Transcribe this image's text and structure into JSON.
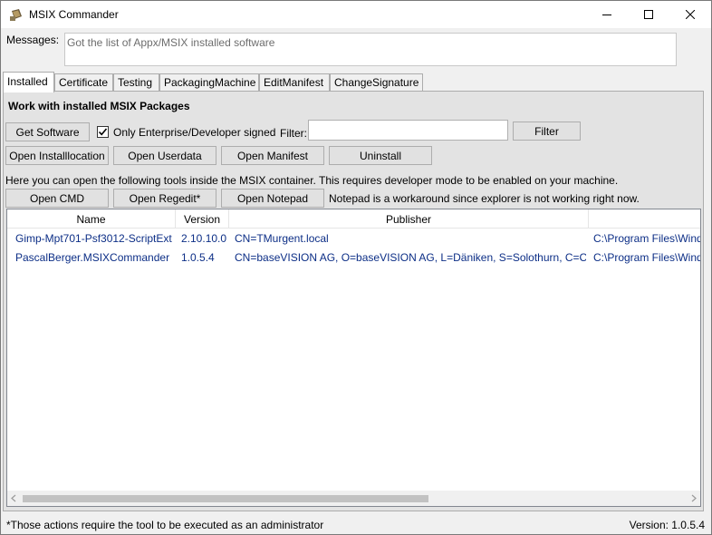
{
  "window": {
    "title": "MSIX Commander",
    "app_icon": "app-icon"
  },
  "messages": {
    "label": "Messages:",
    "text": "Got the list of Appx/MSIX installed software"
  },
  "tabs": [
    {
      "label": "Installed",
      "active": true
    },
    {
      "label": "Certificate",
      "active": false
    },
    {
      "label": "Testing",
      "active": false
    },
    {
      "label": "PackagingMachine",
      "active": false
    },
    {
      "label": "EditManifest",
      "active": false
    },
    {
      "label": "ChangeSignature",
      "active": false
    }
  ],
  "installed": {
    "title": "Work with installed MSIX Packages",
    "get_software": "Get Software",
    "only_enterprise_label": "Only Enterprise/Developer signed",
    "only_enterprise_checked": true,
    "filter_label": "Filter:",
    "filter_value": "",
    "filter_button": "Filter",
    "open_installlocation": "Open Installlocation",
    "open_userdata": "Open Userdata",
    "open_manifest": "Open Manifest",
    "uninstall": "Uninstall",
    "info": "Here you can open the following tools inside the MSIX container. This requires developer mode to be enabled on your machine.",
    "open_cmd": "Open CMD",
    "open_regedit": "Open Regedit*",
    "open_notepad": "Open Notepad",
    "note": "Notepad is a workaround since explorer is not working right now."
  },
  "grid": {
    "columns": [
      "Name",
      "Version",
      "Publisher",
      ""
    ],
    "rows": [
      {
        "name": "Gimp-Mpt701-Psf3012-ScriptExt",
        "version": "2.10.10.0",
        "publisher": "CN=TMurgent.local",
        "location": "C:\\Program Files\\Wind"
      },
      {
        "name": "PascalBerger.MSIXCommander",
        "version": "1.0.5.4",
        "publisher": "CN=baseVISION AG, O=baseVISION AG, L=Däniken, S=Solothurn, C=CH",
        "location": "C:\\Program Files\\Wind"
      }
    ]
  },
  "footer": {
    "note": "*Those actions require the tool to be executed as an administrator",
    "version": "Version: 1.0.5.4"
  }
}
